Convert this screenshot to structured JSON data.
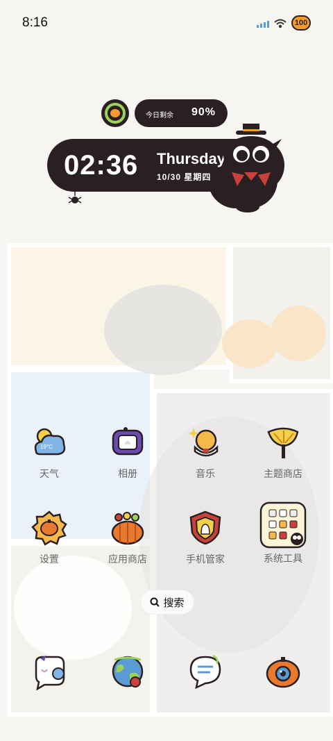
{
  "status_bar": {
    "time": "8:16",
    "battery": "100"
  },
  "widget": {
    "battery_label": "今日剩余",
    "battery_percent": "90%",
    "clock": "02:36",
    "weekday": "Thursday",
    "date": "10/30  星期四"
  },
  "apps": [
    {
      "label": "天气",
      "icon": "weather-icon",
      "temp": "19°C"
    },
    {
      "label": "相册",
      "icon": "gallery-icon"
    },
    {
      "label": "音乐",
      "icon": "music-icon"
    },
    {
      "label": "主题商店",
      "icon": "theme-store-icon"
    },
    {
      "label": "设置",
      "icon": "settings-icon"
    },
    {
      "label": "应用商店",
      "icon": "app-store-icon"
    },
    {
      "label": "手机管家",
      "icon": "phone-manager-icon"
    },
    {
      "label": "系统工具",
      "icon": "system-tools-folder-icon"
    }
  ],
  "search": {
    "label": "搜索"
  },
  "dock": [
    {
      "icon": "messages-icon"
    },
    {
      "icon": "browser-icon"
    },
    {
      "icon": "notes-icon"
    },
    {
      "icon": "camera-icon"
    }
  ],
  "colors": {
    "dark": "#2a1f23",
    "accent": "#f39a2e",
    "green": "#9bd35a"
  }
}
